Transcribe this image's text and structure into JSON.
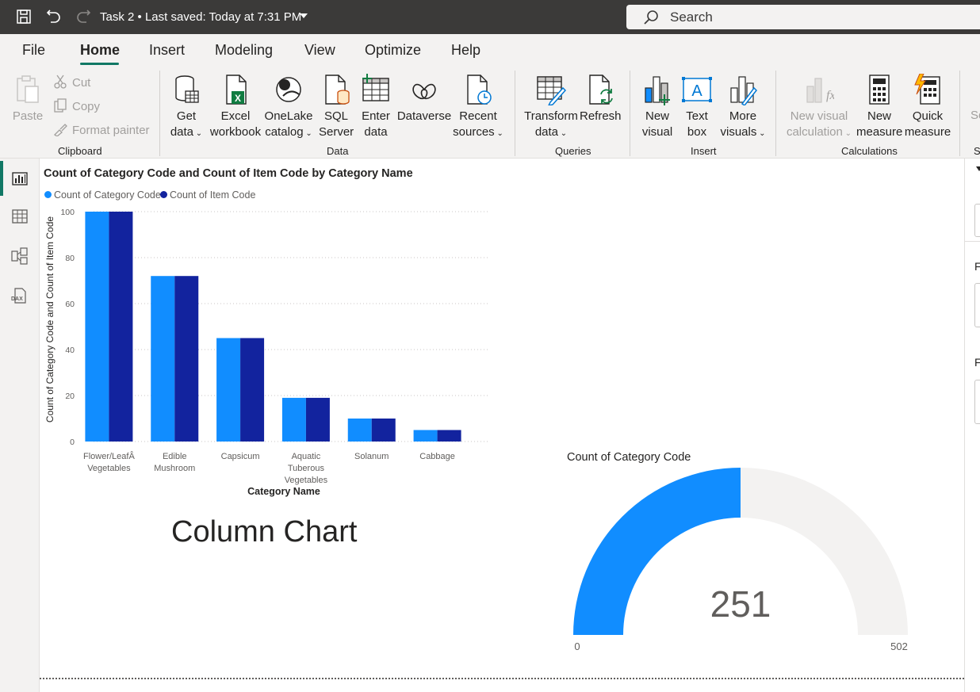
{
  "titlebar": {
    "doc_title": "Task 2 • Last saved: Today at 7:31 PM",
    "search_placeholder": "Search"
  },
  "menu": {
    "tabs": [
      {
        "label": "File"
      },
      {
        "label": "Home",
        "active": true
      },
      {
        "label": "Insert"
      },
      {
        "label": "Modeling"
      },
      {
        "label": "View"
      },
      {
        "label": "Optimize"
      },
      {
        "label": "Help"
      }
    ]
  },
  "ribbon": {
    "clipboard": {
      "paste": "Paste",
      "cut": "Cut",
      "copy": "Copy",
      "format_painter": "Format painter",
      "group": "Clipboard"
    },
    "data": {
      "get_data": [
        "Get",
        "data"
      ],
      "excel": [
        "Excel",
        "workbook"
      ],
      "onelake": [
        "OneLake",
        "catalog"
      ],
      "sql": [
        "SQL",
        "Server"
      ],
      "enter": [
        "Enter",
        "data"
      ],
      "dataverse": "Dataverse",
      "recent": [
        "Recent",
        "sources"
      ],
      "group": "Data"
    },
    "queries": {
      "transform": [
        "Transform",
        "data"
      ],
      "refresh": "Refresh",
      "group": "Queries"
    },
    "insert": {
      "new_visual": [
        "New",
        "visual"
      ],
      "text_box": [
        "Text",
        "box"
      ],
      "more_visuals": [
        "More",
        "visuals"
      ],
      "group": "Insert"
    },
    "calculations": {
      "new_visual_calc": [
        "New visual",
        "calculation"
      ],
      "new_measure": [
        "New",
        "measure"
      ],
      "quick_measure": [
        "Quick",
        "measure"
      ],
      "group": "Calculations"
    },
    "overflow": {
      "partial_label": "Se",
      "partial_group": "S"
    }
  },
  "rightpane": {
    "label_1": "F",
    "label_2": "F"
  },
  "colors": {
    "series1": "#118dff",
    "series2": "#12239e",
    "gauge_fill": "#118dff",
    "gauge_track": "#f3f2f1",
    "accent": "#117865"
  },
  "chart_data": [
    {
      "type": "bar",
      "title": "Count of Category Code and Count of Item Code by Category Name",
      "xlabel": "Category Name",
      "ylabel": "Count of Category Code and Count of Item Code",
      "categories": [
        [
          "Flower/LeafÂ",
          "Vegetables"
        ],
        [
          "Edible",
          "Mushroom"
        ],
        [
          "Capsicum"
        ],
        [
          "Aquatic",
          "Tuberous",
          "Vegetables"
        ],
        [
          "Solanum"
        ],
        [
          "Cabbage"
        ]
      ],
      "series": [
        {
          "name": "Count of Category Code",
          "values": [
            100,
            72,
            45,
            19,
            10,
            5
          ]
        },
        {
          "name": "Count of Item Code",
          "values": [
            100,
            72,
            45,
            19,
            10,
            5
          ]
        }
      ],
      "ylim": [
        0,
        100
      ],
      "yticks": [
        "0",
        "20",
        "40",
        "60",
        "80",
        "100"
      ],
      "grid": true,
      "legend": "top-left"
    },
    {
      "type": "gauge",
      "title": "Count of Category Code",
      "value": 251,
      "value_label": "251",
      "min": 0,
      "max": 502,
      "min_label": "0",
      "max_label": "502"
    }
  ],
  "caption": "Column Chart"
}
